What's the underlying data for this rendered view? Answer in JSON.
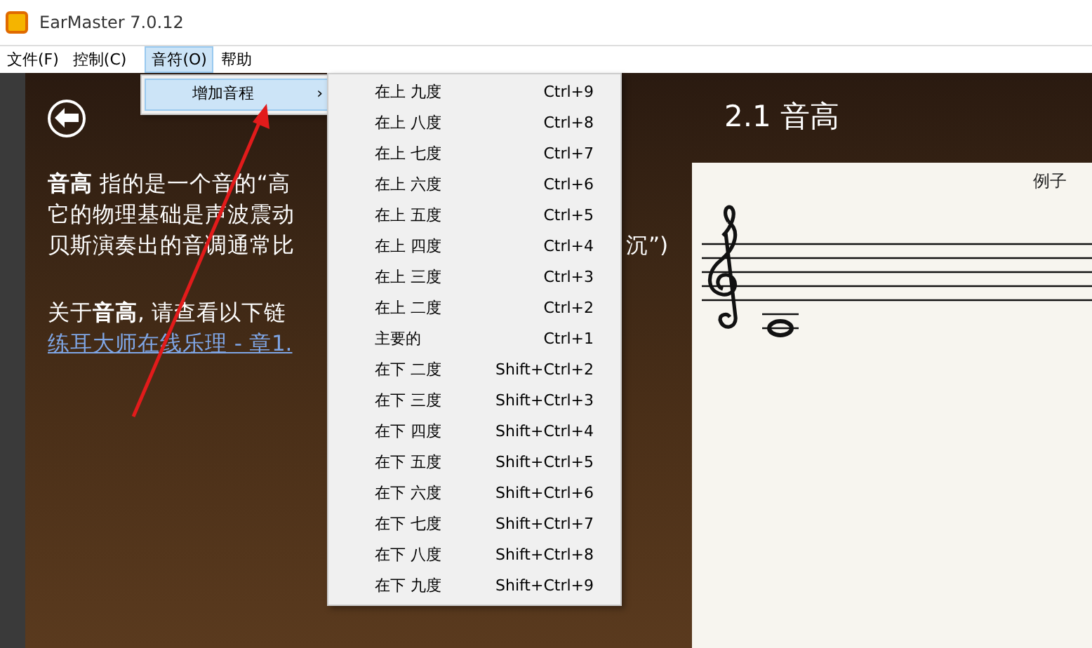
{
  "window": {
    "title": "EarMaster 7.0.12"
  },
  "menu_bar": [
    {
      "label": "文件(F)",
      "selected": false
    },
    {
      "label": "控制(C)",
      "selected": false
    },
    {
      "label": "音符(O)",
      "selected": true
    },
    {
      "label": "帮助",
      "selected": false
    }
  ],
  "note_menu": {
    "items": [
      {
        "label": "增加音程",
        "arrow": "›",
        "selected": true
      }
    ]
  },
  "interval_submenu": {
    "items": [
      {
        "label": "在上 九度",
        "shortcut": "Ctrl+9"
      },
      {
        "label": "在上 八度",
        "shortcut": "Ctrl+8"
      },
      {
        "label": "在上 七度",
        "shortcut": "Ctrl+7"
      },
      {
        "label": "在上 六度",
        "shortcut": "Ctrl+6"
      },
      {
        "label": "在上 五度",
        "shortcut": "Ctrl+5"
      },
      {
        "label": "在上 四度",
        "shortcut": "Ctrl+4"
      },
      {
        "label": "在上 三度",
        "shortcut": "Ctrl+3"
      },
      {
        "label": "在上 二度",
        "shortcut": "Ctrl+2"
      },
      {
        "label": "主要的",
        "shortcut": "Ctrl+1"
      },
      {
        "label": "在下 二度",
        "shortcut": "Shift+Ctrl+2"
      },
      {
        "label": "在下 三度",
        "shortcut": "Shift+Ctrl+3"
      },
      {
        "label": "在下 四度",
        "shortcut": "Shift+Ctrl+4"
      },
      {
        "label": "在下 五度",
        "shortcut": "Shift+Ctrl+5"
      },
      {
        "label": "在下 六度",
        "shortcut": "Shift+Ctrl+6"
      },
      {
        "label": "在下 七度",
        "shortcut": "Shift+Ctrl+7"
      },
      {
        "label": "在下 八度",
        "shortcut": "Shift+Ctrl+8"
      },
      {
        "label": "在下 九度",
        "shortcut": "Shift+Ctrl+9"
      }
    ]
  },
  "lesson": {
    "title": "2.1 音高",
    "text_lines": [
      "**音高** 指的是一个音的“高",
      "它的物理基础是声波震动",
      "贝斯演奏出的音调通常比"
    ],
    "line_tail": "沉”)",
    "links_intro": "关于**音高**, 请查看以下链",
    "link": "练耳大师在线乐理 - 章1.",
    "example_label": "例子"
  }
}
